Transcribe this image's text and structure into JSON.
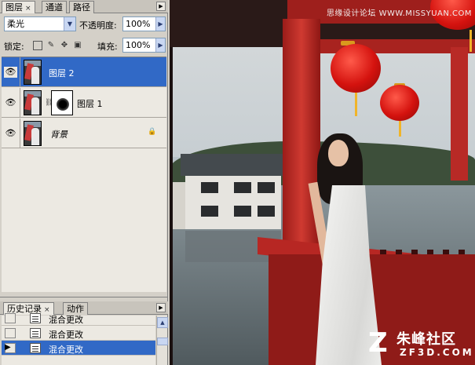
{
  "layers_panel": {
    "tabs": [
      {
        "label": "图层",
        "close": "×"
      },
      {
        "label": "通道"
      },
      {
        "label": "路径"
      }
    ],
    "menu_icon": "panel-menu-icon",
    "blend_mode": "柔光",
    "opacity_label": "不透明度:",
    "opacity_value": "100%",
    "lock_label": "锁定:",
    "fill_label": "填充:",
    "fill_value": "100%",
    "layers": [
      {
        "name": "图层 2",
        "selected": true,
        "visible": true
      },
      {
        "name": "图层 1",
        "selected": false,
        "visible": true,
        "has_mask": true
      },
      {
        "name": "背景",
        "selected": false,
        "visible": true,
        "locked": true
      }
    ]
  },
  "history_panel": {
    "tabs": [
      {
        "label": "历史记录",
        "close": "×"
      },
      {
        "label": "动作"
      }
    ],
    "items": [
      {
        "label": "混合更改",
        "selected": false
      },
      {
        "label": "混合更改",
        "selected": false
      },
      {
        "label": "混合更改",
        "selected": true
      }
    ]
  },
  "canvas": {
    "watermark_top": "思缘设计论坛 WWW.MISSYUAN.COM",
    "logo_mark": "Z",
    "logo_text": "朱峰社区",
    "logo_sub": "ZF3D.COM"
  },
  "colors": {
    "selection": "#3169c6",
    "panel_bg": "#d4d0c8",
    "pillar_red": "#cf3a31"
  }
}
